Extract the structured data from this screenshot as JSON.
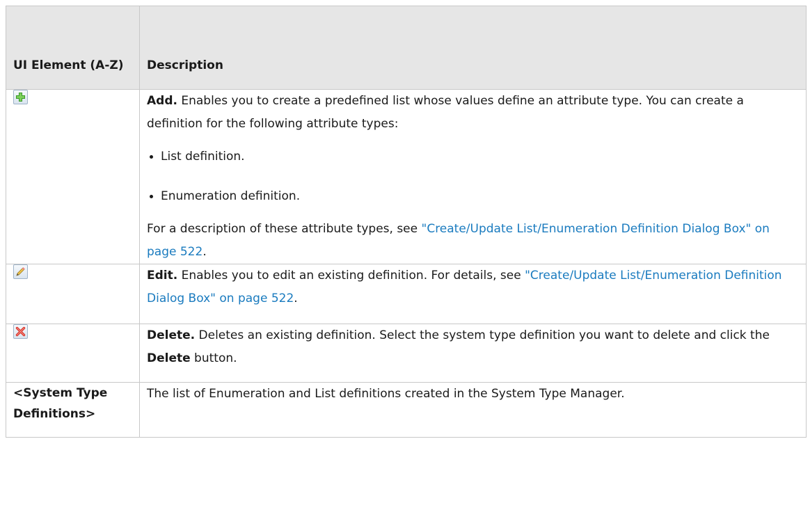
{
  "table": {
    "headers": [
      "UI Element (A-Z)",
      "Description"
    ],
    "rows": [
      {
        "icon": "add-icon",
        "term": "Add.",
        "text": " Enables you to create a predefined list whose values define an attribute type. You can create a definition for the following attribute types:",
        "bullets": [
          "List definition.",
          "Enumeration definition."
        ],
        "after_prefix": "For a description of these attribute types, see ",
        "after_link": "\"Create/Update List/Enumeration Definition Dialog Box\" on page 522",
        "after_suffix": "."
      },
      {
        "icon": "edit-icon",
        "term": "Edit.",
        "text": " Enables you to edit an existing definition. For details, see ",
        "link": "\"Create/Update List/Enumeration Definition Dialog Box\" on page 522",
        "suffix": "."
      },
      {
        "icon": "delete-icon",
        "term": "Delete.",
        "text": " Deletes an existing definition. Select the system type definition you want to delete and click the ",
        "bold_inline": "Delete",
        "suffix": " button."
      },
      {
        "element": "<System Type Definitions>",
        "text": "The list of Enumeration and List definitions created in the System Type Manager."
      }
    ]
  },
  "colors": {
    "header_bg": "#e6e6e6",
    "border": "#c8c8c8",
    "link": "#1a7bbf",
    "add_icon": "#3a9a2a",
    "delete_icon": "#d9362c"
  }
}
